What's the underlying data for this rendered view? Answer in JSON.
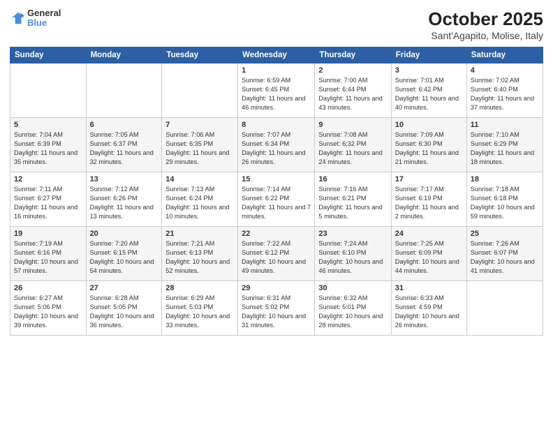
{
  "header": {
    "logo_line1": "General",
    "logo_line2": "Blue",
    "title": "October 2025",
    "subtitle": "Sant'Agapito, Molise, Italy"
  },
  "days_of_week": [
    "Sunday",
    "Monday",
    "Tuesday",
    "Wednesday",
    "Thursday",
    "Friday",
    "Saturday"
  ],
  "weeks": [
    [
      {
        "day": "",
        "info": ""
      },
      {
        "day": "",
        "info": ""
      },
      {
        "day": "",
        "info": ""
      },
      {
        "day": "1",
        "info": "Sunrise: 6:59 AM\nSunset: 6:45 PM\nDaylight: 11 hours and 46 minutes."
      },
      {
        "day": "2",
        "info": "Sunrise: 7:00 AM\nSunset: 6:44 PM\nDaylight: 11 hours and 43 minutes."
      },
      {
        "day": "3",
        "info": "Sunrise: 7:01 AM\nSunset: 6:42 PM\nDaylight: 11 hours and 40 minutes."
      },
      {
        "day": "4",
        "info": "Sunrise: 7:02 AM\nSunset: 6:40 PM\nDaylight: 11 hours and 37 minutes."
      }
    ],
    [
      {
        "day": "5",
        "info": "Sunrise: 7:04 AM\nSunset: 6:39 PM\nDaylight: 11 hours and 35 minutes."
      },
      {
        "day": "6",
        "info": "Sunrise: 7:05 AM\nSunset: 6:37 PM\nDaylight: 11 hours and 32 minutes."
      },
      {
        "day": "7",
        "info": "Sunrise: 7:06 AM\nSunset: 6:35 PM\nDaylight: 11 hours and 29 minutes."
      },
      {
        "day": "8",
        "info": "Sunrise: 7:07 AM\nSunset: 6:34 PM\nDaylight: 11 hours and 26 minutes."
      },
      {
        "day": "9",
        "info": "Sunrise: 7:08 AM\nSunset: 6:32 PM\nDaylight: 11 hours and 24 minutes."
      },
      {
        "day": "10",
        "info": "Sunrise: 7:09 AM\nSunset: 6:30 PM\nDaylight: 11 hours and 21 minutes."
      },
      {
        "day": "11",
        "info": "Sunrise: 7:10 AM\nSunset: 6:29 PM\nDaylight: 11 hours and 18 minutes."
      }
    ],
    [
      {
        "day": "12",
        "info": "Sunrise: 7:11 AM\nSunset: 6:27 PM\nDaylight: 11 hours and 16 minutes."
      },
      {
        "day": "13",
        "info": "Sunrise: 7:12 AM\nSunset: 6:26 PM\nDaylight: 11 hours and 13 minutes."
      },
      {
        "day": "14",
        "info": "Sunrise: 7:13 AM\nSunset: 6:24 PM\nDaylight: 11 hours and 10 minutes."
      },
      {
        "day": "15",
        "info": "Sunrise: 7:14 AM\nSunset: 6:22 PM\nDaylight: 11 hours and 7 minutes."
      },
      {
        "day": "16",
        "info": "Sunrise: 7:16 AM\nSunset: 6:21 PM\nDaylight: 11 hours and 5 minutes."
      },
      {
        "day": "17",
        "info": "Sunrise: 7:17 AM\nSunset: 6:19 PM\nDaylight: 11 hours and 2 minutes."
      },
      {
        "day": "18",
        "info": "Sunrise: 7:18 AM\nSunset: 6:18 PM\nDaylight: 10 hours and 59 minutes."
      }
    ],
    [
      {
        "day": "19",
        "info": "Sunrise: 7:19 AM\nSunset: 6:16 PM\nDaylight: 10 hours and 57 minutes."
      },
      {
        "day": "20",
        "info": "Sunrise: 7:20 AM\nSunset: 6:15 PM\nDaylight: 10 hours and 54 minutes."
      },
      {
        "day": "21",
        "info": "Sunrise: 7:21 AM\nSunset: 6:13 PM\nDaylight: 10 hours and 52 minutes."
      },
      {
        "day": "22",
        "info": "Sunrise: 7:22 AM\nSunset: 6:12 PM\nDaylight: 10 hours and 49 minutes."
      },
      {
        "day": "23",
        "info": "Sunrise: 7:24 AM\nSunset: 6:10 PM\nDaylight: 10 hours and 46 minutes."
      },
      {
        "day": "24",
        "info": "Sunrise: 7:25 AM\nSunset: 6:09 PM\nDaylight: 10 hours and 44 minutes."
      },
      {
        "day": "25",
        "info": "Sunrise: 7:26 AM\nSunset: 6:07 PM\nDaylight: 10 hours and 41 minutes."
      }
    ],
    [
      {
        "day": "26",
        "info": "Sunrise: 6:27 AM\nSunset: 5:06 PM\nDaylight: 10 hours and 39 minutes."
      },
      {
        "day": "27",
        "info": "Sunrise: 6:28 AM\nSunset: 5:05 PM\nDaylight: 10 hours and 36 minutes."
      },
      {
        "day": "28",
        "info": "Sunrise: 6:29 AM\nSunset: 5:03 PM\nDaylight: 10 hours and 33 minutes."
      },
      {
        "day": "29",
        "info": "Sunrise: 6:31 AM\nSunset: 5:02 PM\nDaylight: 10 hours and 31 minutes."
      },
      {
        "day": "30",
        "info": "Sunrise: 6:32 AM\nSunset: 5:01 PM\nDaylight: 10 hours and 28 minutes."
      },
      {
        "day": "31",
        "info": "Sunrise: 6:33 AM\nSunset: 4:59 PM\nDaylight: 10 hours and 26 minutes."
      },
      {
        "day": "",
        "info": ""
      }
    ]
  ]
}
